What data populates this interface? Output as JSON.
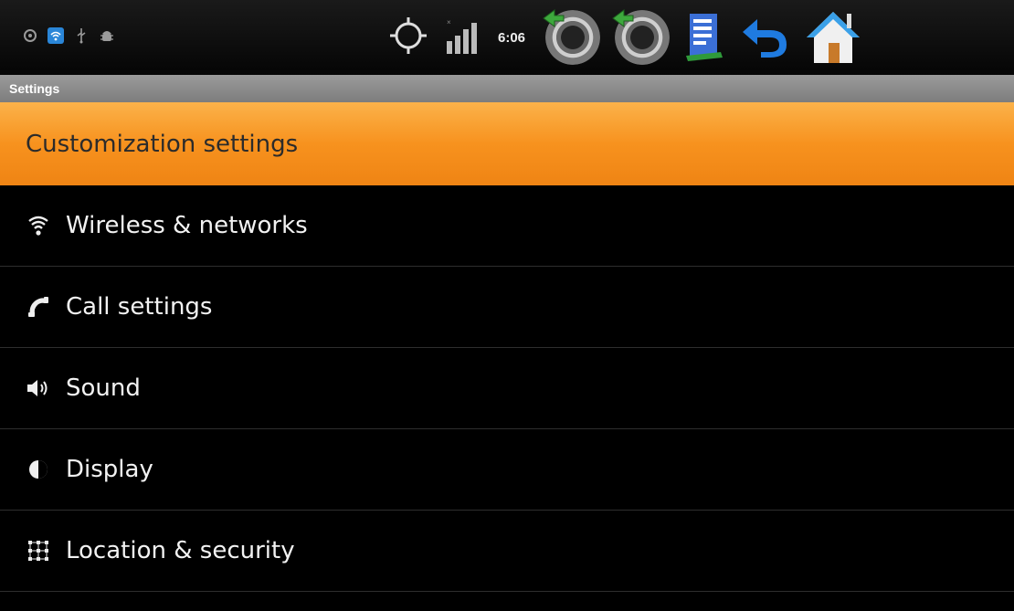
{
  "status_bar": {
    "time": "6:06",
    "icons": [
      "sync-icon",
      "wifi-notification-icon",
      "usb-icon",
      "android-debug-icon",
      "gps-icon",
      "signal-strength-icon",
      "menu-key-icon",
      "volume-down-icon",
      "document-icon",
      "back-icon",
      "home-icon"
    ]
  },
  "title_bar": {
    "title": "Settings"
  },
  "settings_list": {
    "items": [
      {
        "label": "Customization settings",
        "icon": "",
        "selected": true
      },
      {
        "label": "Wireless & networks",
        "icon": "wifi-icon"
      },
      {
        "label": "Call settings",
        "icon": "phone-icon"
      },
      {
        "label": "Sound",
        "icon": "speaker-icon"
      },
      {
        "label": "Display",
        "icon": "brightness-icon"
      },
      {
        "label": "Location & security",
        "icon": "location-grid-icon"
      }
    ]
  },
  "colors": {
    "accent": "#f7921e",
    "background": "#000000",
    "title_bar": "#8a8a8a"
  }
}
